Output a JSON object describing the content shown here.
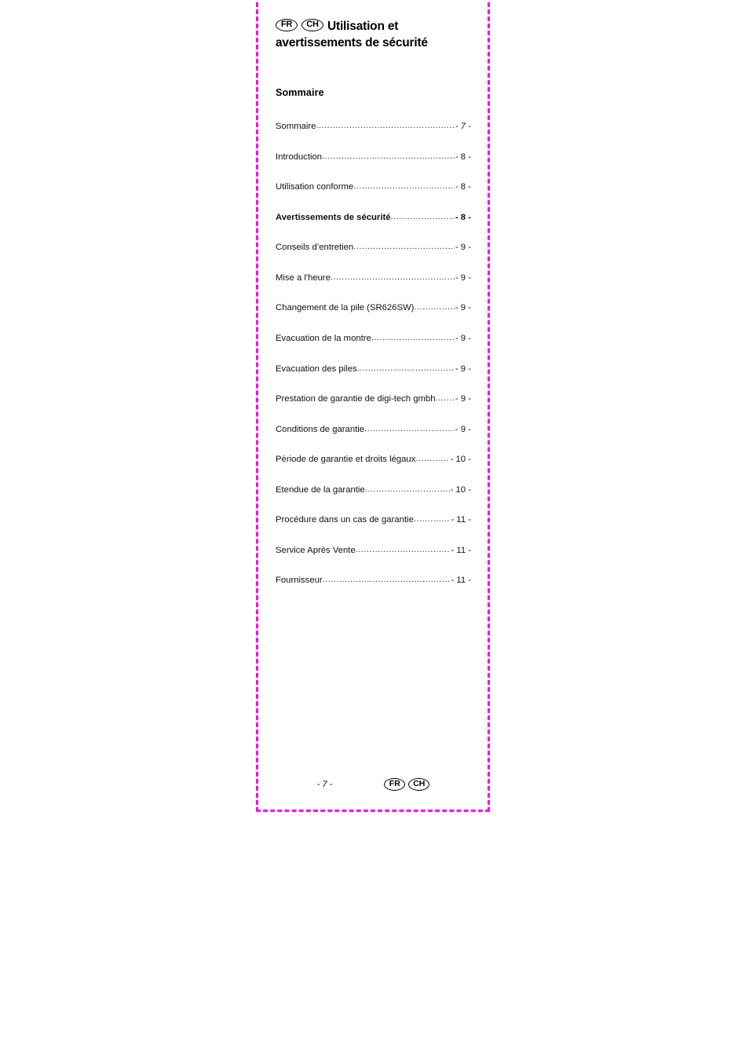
{
  "document": {
    "language_badges": [
      "FR",
      "CH"
    ],
    "title_lines": [
      "Utilisation et",
      "avertissements de sécurité"
    ],
    "toc_heading": "Sommaire",
    "dot_leader": "....................................................................................................",
    "toc_entries": [
      {
        "label": "Sommaire",
        "page": "- 7 -",
        "bold": false,
        "italic": true
      },
      {
        "label": "Introduction",
        "page": "- 8 -",
        "bold": false,
        "italic": false
      },
      {
        "label": "Utilisation conforme",
        "page": "- 8 -",
        "bold": false,
        "italic": false
      },
      {
        "label": "Avertissements de sécurité",
        "page": "- 8 -",
        "bold": true,
        "italic": false
      },
      {
        "label": "Conseils d’entretien",
        "page": "- 9 -",
        "bold": false,
        "italic": false
      },
      {
        "label": "Mise a l'heure",
        "page": "- 9 -",
        "bold": false,
        "italic": false
      },
      {
        "label": "Changement de la pile (SR626SW)",
        "page": "- 9 -",
        "bold": false,
        "italic": false
      },
      {
        "label": "Evacuation de la montre",
        "page": "- 9 -",
        "bold": false,
        "italic": false
      },
      {
        "label": "Evacuation des piles",
        "page": "- 9 -",
        "bold": false,
        "italic": false
      },
      {
        "label": "Prestation de garantie de digi-tech gmbh",
        "page": "- 9 -",
        "bold": false,
        "italic": false
      },
      {
        "label": "Conditions de garantie",
        "page": "- 9 -",
        "bold": false,
        "italic": false
      },
      {
        "label": "Période de garantie et droits légaux",
        "page": "- 10 -",
        "bold": false,
        "italic": false
      },
      {
        "label": "Etendue de la garantie",
        "page": "- 10 -",
        "bold": false,
        "italic": false
      },
      {
        "label": "Procédure dans un cas de garantie",
        "page": "- 11 -",
        "bold": false,
        "italic": false
      },
      {
        "label": "Service Après Vente",
        "page": "- 11 -",
        "bold": false,
        "italic": false
      },
      {
        "label": "Fournisseur",
        "page": "- 11 -",
        "bold": false,
        "italic": false
      }
    ],
    "footer": {
      "page_number": "- 7 -",
      "badges": [
        "FR",
        "CH"
      ]
    },
    "colors": {
      "frame": "#ff00ee",
      "text": "#000000",
      "page_background": "#ffffff"
    }
  }
}
